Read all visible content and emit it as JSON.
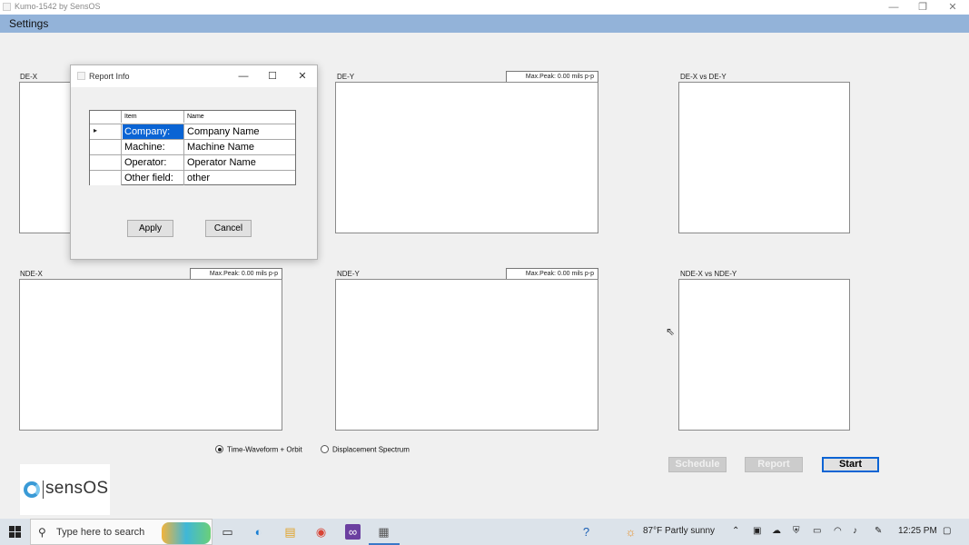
{
  "window": {
    "title": "Kumo-1542 by SensOS",
    "minimize": "—",
    "restore": "❐",
    "close": "✕"
  },
  "menu": {
    "settings": "Settings"
  },
  "plots": {
    "de_x": {
      "label": "DE-X"
    },
    "de_y": {
      "label": "DE-Y",
      "peak": "Max.Peak: 0.00 mils p-p"
    },
    "de_xy": {
      "label": "DE-X vs DE-Y"
    },
    "nde_x": {
      "label": "NDE-X",
      "peak": "Max.Peak: 0.00 mils p-p"
    },
    "nde_y": {
      "label": "NDE-Y",
      "peak": "Max.Peak: 0.00 mils p-p"
    },
    "nde_xy": {
      "label": "NDE-X vs NDE-Y"
    }
  },
  "dialog": {
    "title": "Report Info",
    "minimize": "—",
    "maximize": "☐",
    "close": "✕",
    "columns": {
      "item": "Item",
      "name": "Name"
    },
    "rows": [
      {
        "item": "Company:",
        "name": "Company Name"
      },
      {
        "item": "Machine:",
        "name": "Machine Name"
      },
      {
        "item": "Operator:",
        "name": "Operator Name"
      },
      {
        "item": "Other field:",
        "name": "other"
      }
    ],
    "row_pointer": "▸",
    "apply": "Apply",
    "cancel": "Cancel"
  },
  "mode": {
    "time_waveform": "Time-Waveform + Orbit",
    "displacement": "Displacement Spectrum",
    "selected": "time_waveform"
  },
  "buttons": {
    "schedule": "Schedule",
    "report": "Report",
    "start": "Start"
  },
  "logo": {
    "text": "sensOS"
  },
  "taskbar": {
    "search_placeholder": "Type here to search",
    "search_icon": "⚲",
    "weather": "87°F  Partly sunny",
    "time": "12:25 PM"
  },
  "colors": {
    "accent": "#0a64d4",
    "menubar": "#93b3d9",
    "background": "#f0f0f0"
  }
}
